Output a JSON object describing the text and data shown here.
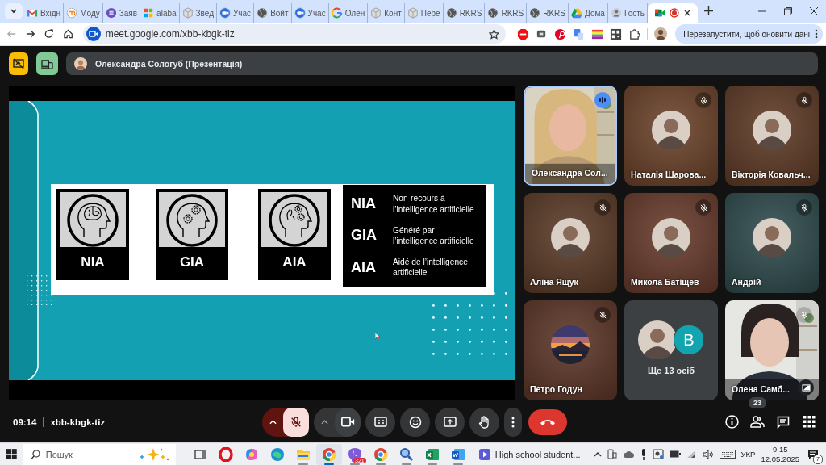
{
  "browser": {
    "tabs": [
      {
        "label": "Вхідн",
        "kind": "mail",
        "selected": false
      },
      {
        "label": "Моду",
        "kind": "moodle",
        "selected": false
      },
      {
        "label": "Заяв",
        "kind": "form",
        "selected": false
      },
      {
        "label": "alaba",
        "kind": "apps",
        "selected": false
      },
      {
        "label": "Звед",
        "kind": "cube",
        "selected": false
      },
      {
        "label": "Учас",
        "kind": "video",
        "selected": false
      },
      {
        "label": "Войт",
        "kind": "globe",
        "selected": false
      },
      {
        "label": "Учас",
        "kind": "video",
        "selected": false
      },
      {
        "label": "Олен",
        "kind": "g",
        "selected": false
      },
      {
        "label": "Конт",
        "kind": "cube",
        "selected": false
      },
      {
        "label": "Пере",
        "kind": "cube",
        "selected": false
      },
      {
        "label": "RKRS",
        "kind": "globe",
        "selected": false
      },
      {
        "label": "RKRS",
        "kind": "globe",
        "selected": false
      },
      {
        "label": "RKRS",
        "kind": "globe",
        "selected": false
      },
      {
        "label": "Дома",
        "kind": "drive",
        "selected": false
      },
      {
        "label": "Гость",
        "kind": "person",
        "selected": false
      },
      {
        "kind": "meet",
        "selected": true
      }
    ],
    "url": "meet.google.com/xbb-kbgk-tiz",
    "update_button": "Перезапустити, щоб оновити дані"
  },
  "meet": {
    "presenter": "Олександра Сологуб (Презентація)",
    "slide": {
      "cards": [
        {
          "label": "NIA",
          "kind": "brain"
        },
        {
          "label": "GIA",
          "kind": "gears"
        },
        {
          "label": "AIA",
          "kind": "brain-gears"
        }
      ],
      "legend": [
        {
          "abbr": "NIA",
          "text": "Non-recours à l’intelligence artificielle"
        },
        {
          "abbr": "GIA",
          "text": "Généré par l’intelligence artificielle"
        },
        {
          "abbr": "AIA",
          "text": "Aidé de l’intelligence artificielle"
        }
      ]
    },
    "tiles": [
      {
        "name": "Олександра Сол...",
        "kind": "video",
        "speaking": true,
        "muted": false
      },
      {
        "name": "Наталія Шарова...",
        "kind": "person-avatar",
        "speaking": false,
        "muted": true,
        "color": "#6b4229"
      },
      {
        "name": "Вікторія Ковальч...",
        "kind": "person-avatar",
        "speaking": false,
        "muted": true,
        "color": "#5f3a25"
      },
      {
        "name": "Аліна Ящук",
        "kind": "person-avatar",
        "speaking": false,
        "muted": true,
        "color": "#5b3a26"
      },
      {
        "name": "Микола Батіщев",
        "kind": "person-avatar",
        "speaking": false,
        "muted": true,
        "color": "#683a2b"
      },
      {
        "name": "Андрій",
        "kind": "person-avatar",
        "speaking": false,
        "muted": true,
        "color": "#2e4a4c"
      },
      {
        "name": "Петро Годун",
        "kind": "landscape-avatar",
        "speaking": false,
        "muted": true,
        "color": "#5d3527"
      },
      {
        "kind": "more",
        "label": "Ще 13 осіб",
        "initial": "B"
      },
      {
        "name": "Олена Самб...",
        "kind": "video",
        "speaking": false,
        "muted": true,
        "pip": true
      }
    ],
    "meeting_time": "09:14",
    "meeting_code": "xbb-kbgk-tiz",
    "mic_muted": true,
    "camera_on": true,
    "participants_count": "23"
  },
  "taskbar": {
    "search_placeholder": "Пошук",
    "apps": [
      {
        "kind": "task-view",
        "running": false,
        "selected": false
      },
      {
        "kind": "ring",
        "running": false,
        "selected": false
      },
      {
        "kind": "swirl",
        "running": false,
        "selected": false
      },
      {
        "kind": "wave",
        "running": false,
        "selected": false
      },
      {
        "kind": "folder",
        "running": true,
        "selected": false
      },
      {
        "kind": "browser",
        "running": true,
        "selected": true
      },
      {
        "kind": "chat",
        "running": true,
        "selected": false,
        "badge": "321"
      },
      {
        "kind": "browser",
        "running": true,
        "selected": false
      },
      {
        "kind": "magnifier",
        "running": true,
        "selected": false
      },
      {
        "kind": "sheet",
        "running": true,
        "selected": false
      },
      {
        "kind": "doc",
        "running": true,
        "selected": false
      }
    ],
    "media": "High school student...",
    "language": "УКР",
    "time": "9:15",
    "date": "12.05.2025",
    "notifications": "7"
  }
}
